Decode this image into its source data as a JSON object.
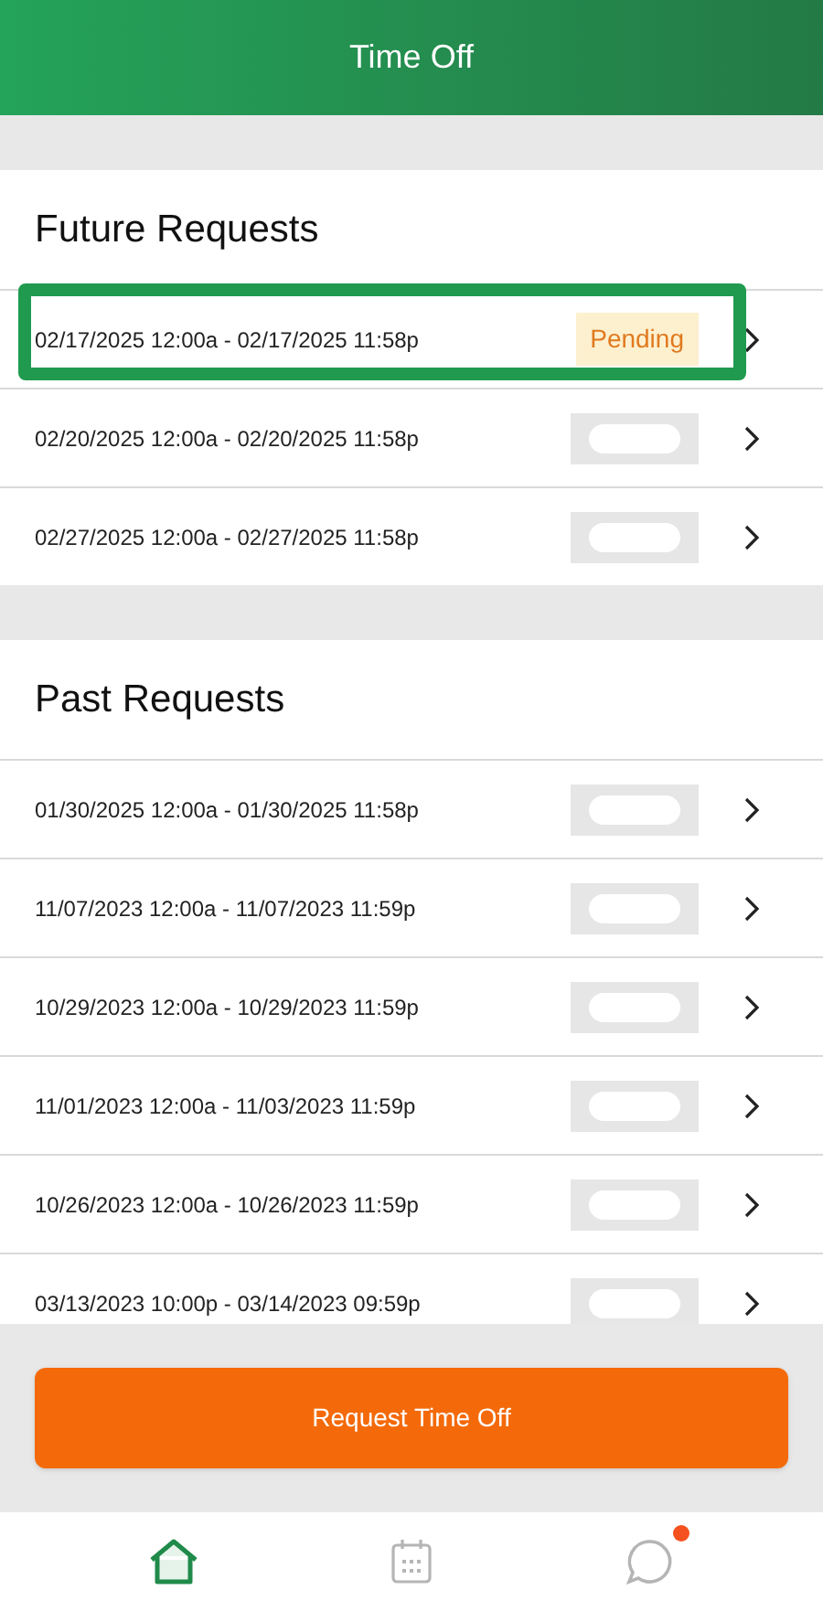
{
  "header": {
    "title": "Time Off"
  },
  "sections": [
    {
      "title": "Future Requests",
      "requests": [
        {
          "dates": "02/17/2025 12:00a - 02/17/2025 11:58p",
          "status": {
            "kind": "pending",
            "label": "Pending"
          },
          "highlighted": true
        },
        {
          "dates": "02/20/2025 12:00a - 02/20/2025 11:58p",
          "status": {
            "kind": "redacted"
          },
          "highlighted": false
        },
        {
          "dates": "02/27/2025 12:00a - 02/27/2025 11:58p",
          "status": {
            "kind": "redacted"
          },
          "highlighted": false
        }
      ]
    },
    {
      "title": "Past Requests",
      "requests": [
        {
          "dates": "01/30/2025 12:00a - 01/30/2025 11:58p",
          "status": {
            "kind": "redacted"
          },
          "highlighted": false
        },
        {
          "dates": "11/07/2023 12:00a - 11/07/2023 11:59p",
          "status": {
            "kind": "redacted"
          },
          "highlighted": false
        },
        {
          "dates": "10/29/2023 12:00a - 10/29/2023 11:59p",
          "status": {
            "kind": "redacted"
          },
          "highlighted": false
        },
        {
          "dates": "11/01/2023 12:00a - 11/03/2023 11:59p",
          "status": {
            "kind": "redacted"
          },
          "highlighted": false
        },
        {
          "dates": "10/26/2023 12:00a - 10/26/2023 11:59p",
          "status": {
            "kind": "redacted"
          },
          "highlighted": false
        },
        {
          "dates": "03/13/2023 10:00p - 03/14/2023 09:59p",
          "status": {
            "kind": "redacted"
          },
          "highlighted": false
        }
      ]
    }
  ],
  "action": {
    "label": "Request Time Off"
  },
  "nav": [
    {
      "kind": "home",
      "selected": true,
      "badge": false
    },
    {
      "kind": "calendar",
      "selected": false,
      "badge": false
    },
    {
      "kind": "chat",
      "selected": false,
      "badge": true
    }
  ]
}
